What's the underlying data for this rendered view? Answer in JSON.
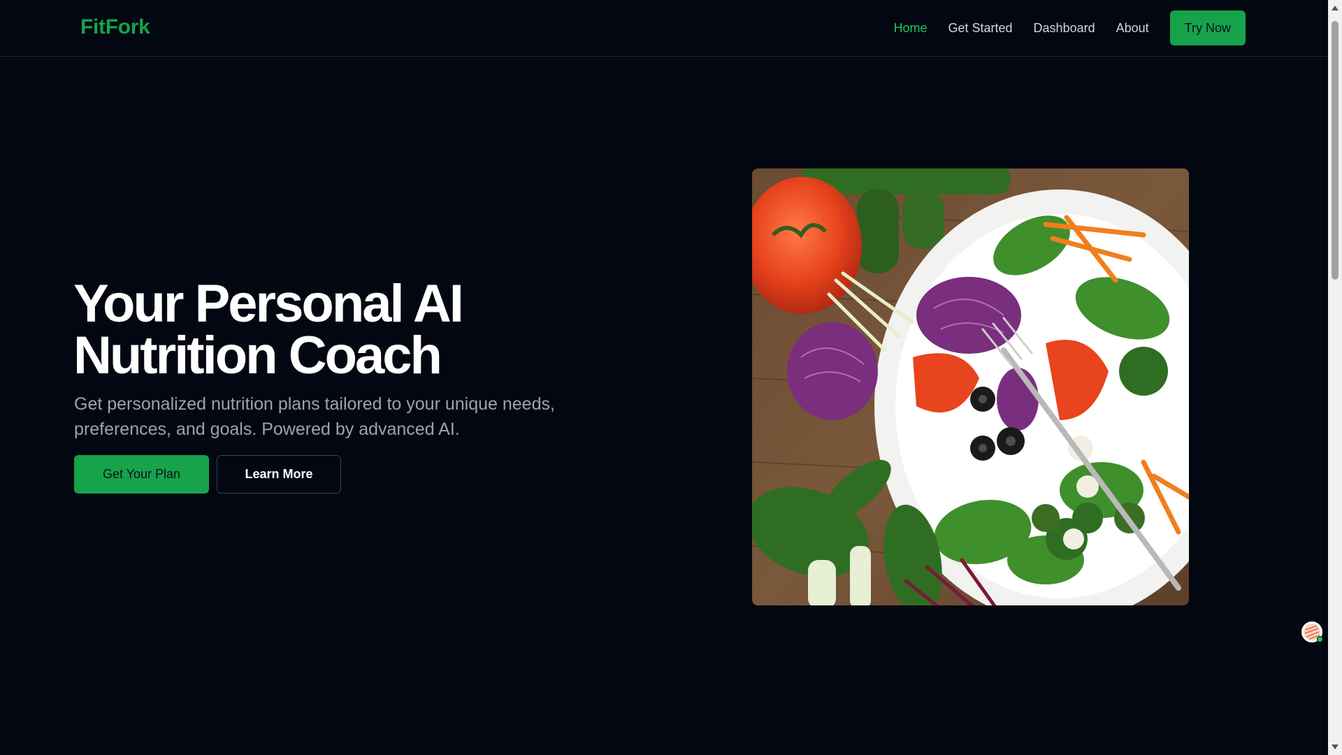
{
  "brand": {
    "name": "FitFork",
    "accent": "#16a34a"
  },
  "nav": {
    "links": [
      {
        "label": "Home",
        "active": true
      },
      {
        "label": "Get Started",
        "active": false
      },
      {
        "label": "Dashboard",
        "active": false
      },
      {
        "label": "About",
        "active": false
      }
    ],
    "cta": "Try Now"
  },
  "hero": {
    "title_line1": "Your Personal AI",
    "title_line2": "Nutrition Coach",
    "subtitle": "Get personalized nutrition plans tailored to your unique needs, preferences, and goals. Powered by advanced AI.",
    "primary_button": "Get Your Plan",
    "secondary_button": "Learn More",
    "image_icon": "salad-photo"
  },
  "chat_widget": {
    "icon": "chat-avatar-icon",
    "status_color": "#22c55e"
  },
  "colors": {
    "background": "#030712",
    "text": "#ffffff",
    "muted": "#9ca3af"
  }
}
